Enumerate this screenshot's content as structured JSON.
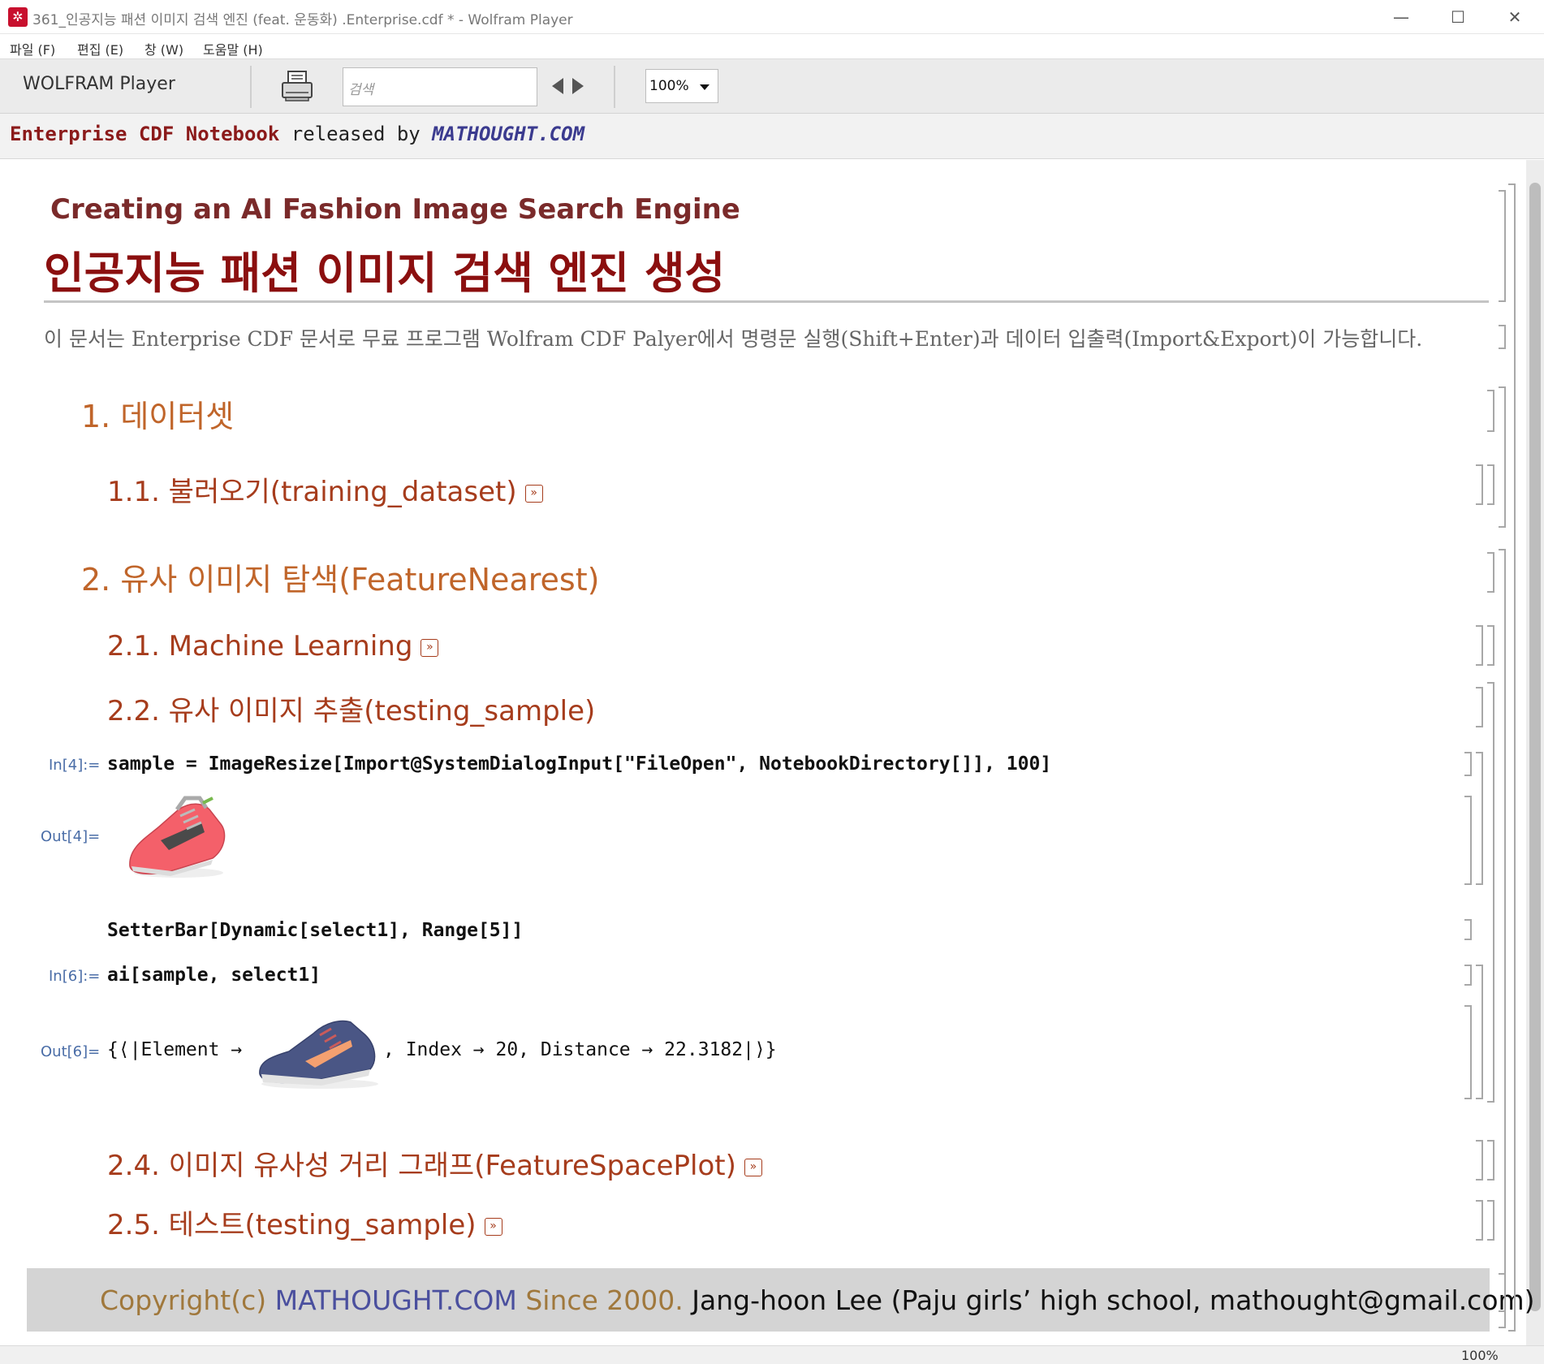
{
  "window": {
    "title": "361_인공지능 패션 이미지 검색 엔진 (feat. 운동화) .Enterprise.cdf * - Wolfram Player",
    "minimize_glyph": "—",
    "maximize_glyph": "☐",
    "close_glyph": "✕",
    "app_icon": "wolfram-gear-icon"
  },
  "menu": {
    "items": [
      "파일 (F)",
      "편집 (E)",
      "창 (W)",
      "도움말 (H)"
    ]
  },
  "toolbar": {
    "brand": "WOLFRAM Player",
    "search_placeholder": "검색",
    "zoom": "100%"
  },
  "enterprise_bar": {
    "part1": "Enterprise CDF Notebook",
    "part2": " released by ",
    "part3": "MATHOUGHT.COM"
  },
  "notebook": {
    "title_en": "Creating an AI Fashion Image Search Engine",
    "title_ko": "인공지능 패션 이미지 검색 엔진 생성",
    "intro": "이 문서는 Enterprise CDF 문서로 무료 프로그램 Wolfram CDF Palyer에서 명령문 실행(Shift+Enter)과 데이터 입출력(Import&Export)이 가능합니다.",
    "sections": {
      "s1": "1. 데이터셋",
      "s1_1": "1.1. 불러오기(training_dataset)",
      "s2": "2. 유사 이미지 탐색(FeatureNearest)",
      "s2_1": "2.1. Machine Learning",
      "s2_2": "2.2. 유사 이미지 추출(testing_sample)",
      "s2_4": "2.4. 이미지 유사성 거리 그래프(FeatureSpacePlot)",
      "s2_5": "2.5. 테스트(testing_sample)"
    },
    "cells": {
      "in4_label": "In[4]:=",
      "in4_code": "sample = ImageResize[Import@SystemDialogInput[\"FileOpen\", NotebookDirectory[]], 100]",
      "out4_label": "Out[4]=",
      "setter_code": "SetterBar[Dynamic[select1], Range[5]]",
      "in6_label": "In[6]:=",
      "in6_code": "ai[sample, select1]",
      "out6_label": "Out[6]=",
      "out6_prefix": "{⟨|Element →",
      "out6_suffix": ", Index → 20, Distance → 22.3182|⟩}"
    },
    "jump_glyph": "»",
    "footer": {
      "part1": "Copyright(c) ",
      "part2": "MATHOUGHT.COM",
      "part3": " Since 2000.  ",
      "part4": "Jang-hoon Lee (Paju girls’ high school, mathought@gmail.com)"
    }
  },
  "status": {
    "zoom": "100%"
  },
  "colors": {
    "title": "#8b0f0f",
    "section": "#c0652a",
    "subsection": "#a63c1c",
    "label": "#4a6da7"
  }
}
